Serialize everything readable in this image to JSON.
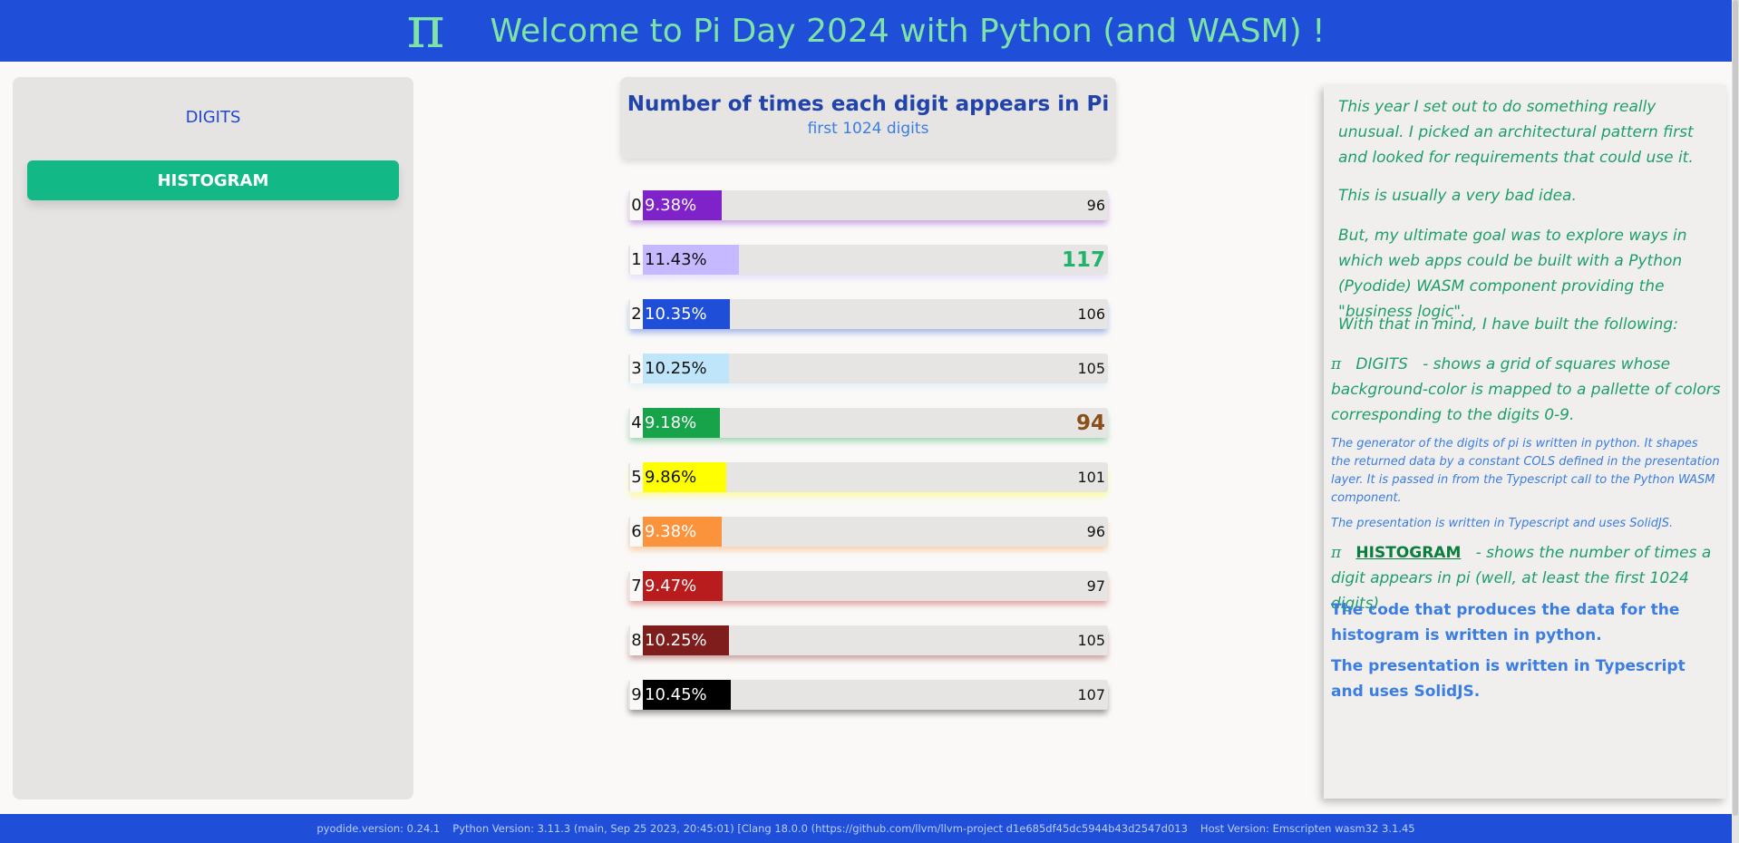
{
  "header": {
    "logo_symbol": "π",
    "title": "Welcome to Pi Day 2024 with Python (and WASM) !"
  },
  "sidebar": {
    "items": [
      {
        "label": "DIGITS",
        "active": false
      },
      {
        "label": "HISTOGRAM",
        "active": true
      }
    ]
  },
  "chart_header": {
    "title": "Number of times each digit appears in Pi",
    "subtitle": "first 1024 digits"
  },
  "chart_data": {
    "type": "bar",
    "categories": [
      "0",
      "1",
      "2",
      "3",
      "4",
      "5",
      "6",
      "7",
      "8",
      "9"
    ],
    "values": [
      96,
      117,
      106,
      105,
      94,
      101,
      96,
      97,
      105,
      107
    ],
    "percent_labels": [
      "9.38%",
      "11.43%",
      "10.35%",
      "10.25%",
      "9.18%",
      "9.86%",
      "9.38%",
      "9.47%",
      "10.25%",
      "10.45%"
    ],
    "count_labels": [
      "96",
      "117",
      "106",
      "105",
      "94",
      "101",
      "96",
      "97",
      "105",
      "107"
    ],
    "colors": [
      "#8022c9",
      "#c6b9ff",
      "#1f4fd9",
      "#bfe5fa",
      "#16a34a",
      "#ffff00",
      "#fb923c",
      "#b91c1c",
      "#7f1d1d",
      "#000000"
    ],
    "text_colors": [
      "#ffffff",
      "#111111",
      "#ffffff",
      "#111111",
      "#ffffff",
      "#111111",
      "#ffffff",
      "#ffffff",
      "#ffffff",
      "#ffffff"
    ],
    "max_index": 1,
    "min_index": 4
  },
  "aside": {
    "p1": "This year I set out to do something really unusual. I picked an architectural pattern first and looked for requirements that could use it.",
    "p2": "This is usually a very bad idea.",
    "p3": "But, my ultimate goal was to explore ways in which web apps could be built with a Python (Pyodide) WASM component providing the \"business logic\".",
    "p4": "With that in mind, I have built the following:",
    "digits_item": {
      "symbol": "π",
      "label": "DIGITS",
      "text": "- shows a grid of squares whose background-color is mapped to a pallette of colors corresponding to the digits 0-9."
    },
    "digits_note1": "The generator of the digits of pi is written in python. It shapes the returned data by a constant COLS defined in the presentation layer. It is passed in from the Typescript call to the Python WASM component.",
    "digits_note2": "The presentation is written in Typescript and uses SolidJS.",
    "histogram_item": {
      "symbol": "π",
      "label": "HISTOGRAM",
      "text": "- shows the number of times a digit appears in pi (well, at least the first 1024 digits)"
    },
    "hist_note1": "The code that produces the data for the histogram is written in python.",
    "hist_note2": "The presentation is written in Typescript and uses SolidJS."
  },
  "footer": {
    "pyodide": "pyodide.version: 0.24.1",
    "python": "Python Version: 3.11.3 (main, Sep 25 2023, 20:45:01) [Clang 18.0.0 (https://github.com/llvm/llvm-project d1e685df45dc5944b43d2547d013",
    "host": "Host Version: Emscripten wasm32 3.1.45"
  }
}
